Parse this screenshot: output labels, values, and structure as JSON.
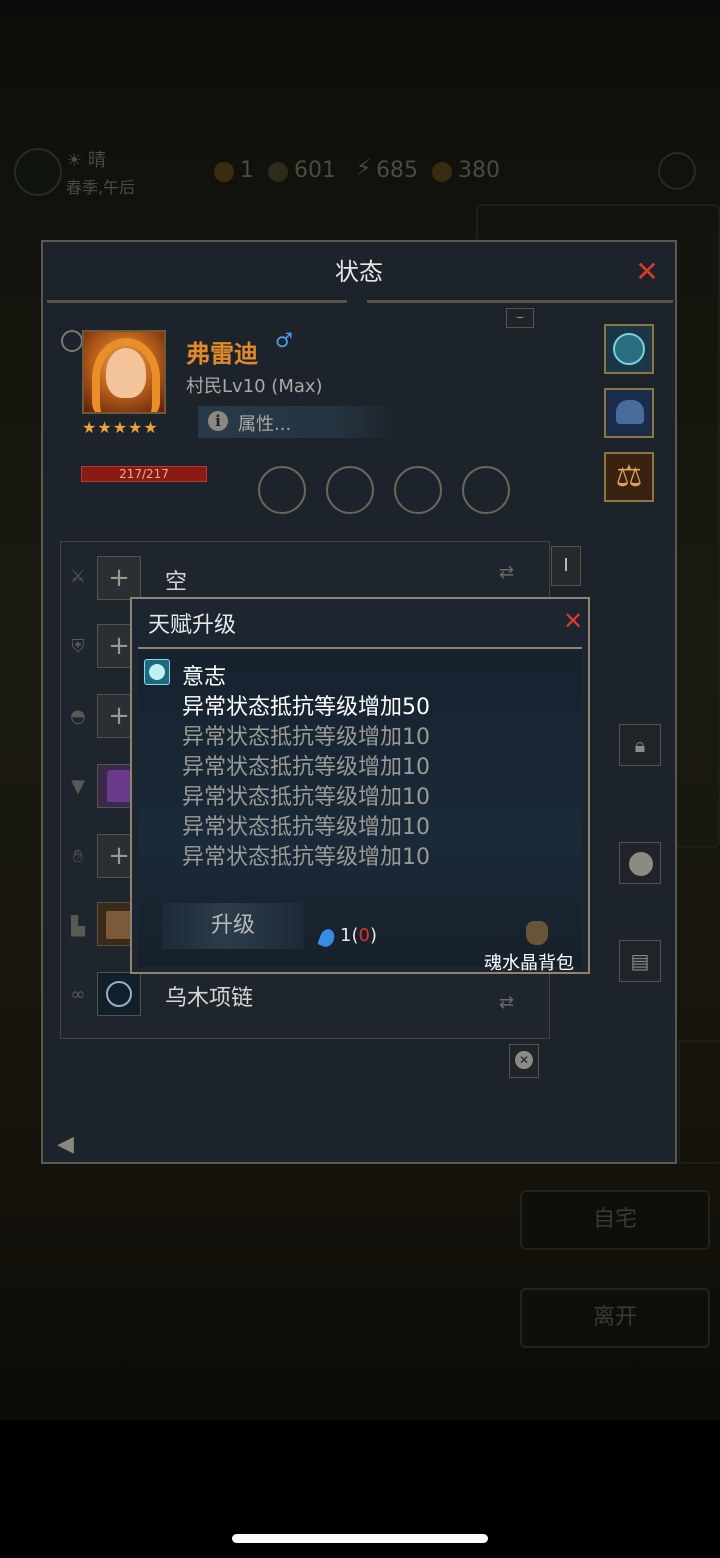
{
  "hud": {
    "weather": "☀ 晴",
    "season": "春季,午后",
    "currency_1": "1",
    "currency_2": "601",
    "currency_3": "685",
    "currency_4": "380"
  },
  "background": {
    "home_button": "自宅",
    "leave_button": "离开"
  },
  "panel": {
    "title": "状态",
    "close": "✕",
    "collapse": "–",
    "character": {
      "name": "弗雷迪",
      "gender_symbol": "♂",
      "level": "村民Lv10 (Max)",
      "attributes_button": "属性...",
      "info_symbol": "i",
      "hp": "217/217",
      "stars": 5
    },
    "equipment": [
      {
        "slot_icon": "sword-icon",
        "name": "空",
        "empty": true
      },
      {
        "slot_icon": "shield-icon",
        "name": "",
        "empty": true
      },
      {
        "slot_icon": "helmet-icon",
        "name": "",
        "empty": true
      },
      {
        "slot_icon": "armor-icon",
        "name": "",
        "empty": false
      },
      {
        "slot_icon": "glove-icon",
        "name": "",
        "empty": true
      },
      {
        "slot_icon": "boot-icon",
        "name": "",
        "empty": false
      },
      {
        "slot_icon": "necklace-icon",
        "name": "乌木项链",
        "empty": false
      }
    ],
    "side_tab": "I"
  },
  "dialog": {
    "title": "天赋升级",
    "close": "✕",
    "talent_name": "意志",
    "effects": [
      "异常状态抵抗等级增加50",
      "异常状态抵抗等级增加10",
      "异常状态抵抗等级增加10",
      "异常状态抵抗等级增加10",
      "异常状态抵抗等级增加10",
      "异常状态抵抗等级增加10"
    ],
    "upgrade_button": "升级",
    "cost_have": "1",
    "cost_open": "(",
    "cost_need": "0",
    "cost_close": ")",
    "bag_label": "魂水晶背包"
  },
  "colors": {
    "accent_orange": "#e08a2a",
    "close_red": "#d83a2c",
    "gender_blue": "#4aa0e8",
    "hp_red": "#8a1a14"
  }
}
